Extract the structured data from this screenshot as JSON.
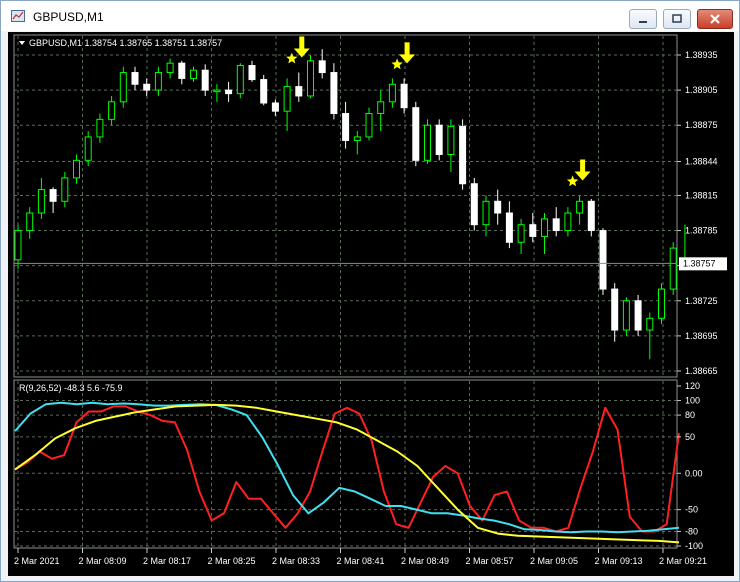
{
  "window": {
    "title": "GBPUSD,M1"
  },
  "chart": {
    "header": "GBPUSD,M1  1.38754 1.38765 1.38751 1.38757",
    "symbol": "GBPUSD",
    "timeframe": "M1",
    "ohlc": {
      "open": "1.38754",
      "high": "1.38765",
      "low": "1.38751",
      "close": "1.38757"
    },
    "price_axis_labels": [
      "1.38935",
      "1.38905",
      "1.38875",
      "1.38844",
      "1.38815",
      "1.38785",
      "1.38755",
      "1.38725",
      "1.38695",
      "1.38665"
    ],
    "price_axis_values": [
      1.38935,
      1.38905,
      1.38875,
      1.38844,
      1.38815,
      1.38785,
      1.38755,
      1.38725,
      1.38695,
      1.38665
    ],
    "current_price": "1.38757",
    "current_price_value": 1.38757,
    "colors": {
      "background": "#000000",
      "bull": "#00ff00",
      "bear": "#ffffff",
      "grid": "#5a6b5a",
      "marker": "#ffff00"
    },
    "signal_markers": [
      {
        "candle": 24,
        "icons": [
          "star-icon",
          "arrow-down-icon"
        ]
      },
      {
        "candle": 33,
        "icons": [
          "star-icon",
          "arrow-down-icon"
        ]
      },
      {
        "candle": 48,
        "icons": [
          "star-icon",
          "arrow-down-icon"
        ]
      }
    ]
  },
  "indicator": {
    "header": "R(9,26,52) -48.3 5.6 -75.9",
    "name": "R",
    "params": "(9,26,52)",
    "values": [
      "-48.3",
      "5.6",
      "-75.9"
    ],
    "axis_labels": [
      "120",
      "100",
      "80",
      "50",
      "0.00",
      "-50",
      "-80",
      "-100"
    ],
    "axis_values": [
      120,
      100,
      80,
      50,
      0,
      -50,
      -80,
      -100
    ],
    "series": [
      {
        "color": "#ff2020",
        "values": [
          5,
          15,
          30,
          20,
          25,
          70,
          85,
          85,
          92,
          92,
          85,
          80,
          72,
          70,
          32,
          -25,
          -65,
          -55,
          -12,
          -35,
          -35,
          -55,
          -75,
          -55,
          -25,
          30,
          82,
          90,
          82,
          45,
          -25,
          -70,
          -75,
          -40,
          -5,
          10,
          0,
          -45,
          -65,
          -30,
          -25,
          -65,
          -75,
          -75,
          -80,
          -75,
          -20,
          30,
          90,
          60,
          -60,
          -80,
          -80,
          -70,
          55
        ]
      },
      {
        "color": "#40e0f0",
        "values": [
          58,
          82,
          95,
          97,
          95,
          97,
          95,
          96,
          95,
          93,
          93,
          94,
          95,
          94,
          88,
          80,
          50,
          12,
          -30,
          -55,
          -40,
          -20,
          -25,
          -35,
          -45,
          -45,
          -50,
          -55,
          -55,
          -58,
          -62,
          -65,
          -70,
          -77,
          -78,
          -80,
          -81,
          -80,
          -80,
          -81,
          -80,
          -79,
          -77,
          -75
        ]
      },
      {
        "color": "#ffff33",
        "values": [
          5,
          25,
          48,
          62,
          72,
          78,
          84,
          88,
          92,
          93,
          94,
          93,
          90,
          85,
          80,
          75,
          70,
          60,
          45,
          30,
          10,
          -20,
          -50,
          -75,
          -83,
          -86,
          -87,
          -88,
          -89,
          -90,
          -91,
          -92,
          -93,
          -95
        ]
      }
    ]
  },
  "time_axis_labels": [
    "2 Mar 2021",
    "2 Mar 08:09",
    "2 Mar 08:17",
    "2 Mar 08:25",
    "2 Mar 08:33",
    "2 Mar 08:41",
    "2 Mar 08:49",
    "2 Mar 08:57",
    "2 Mar 09:05",
    "2 Mar 09:13",
    "2 Mar 09:21"
  ],
  "candles": [
    [
      1.3876,
      1.3879,
      1.38752,
      1.38785
    ],
    [
      1.38785,
      1.38805,
      1.38778,
      1.388
    ],
    [
      1.388,
      1.3883,
      1.38795,
      1.3882
    ],
    [
      1.3882,
      1.38822,
      1.388,
      1.3881
    ],
    [
      1.3881,
      1.38835,
      1.38805,
      1.3883
    ],
    [
      1.3883,
      1.3885,
      1.38825,
      1.38845
    ],
    [
      1.38845,
      1.3887,
      1.3884,
      1.38865
    ],
    [
      1.38865,
      1.38885,
      1.3886,
      1.3888
    ],
    [
      1.3888,
      1.389,
      1.38875,
      1.38895
    ],
    [
      1.38895,
      1.38925,
      1.3889,
      1.3892
    ],
    [
      1.3892,
      1.38925,
      1.38905,
      1.3891
    ],
    [
      1.3891,
      1.38915,
      1.389,
      1.38905
    ],
    [
      1.38905,
      1.38925,
      1.389,
      1.3892
    ],
    [
      1.3892,
      1.38932,
      1.38915,
      1.38928
    ],
    [
      1.38928,
      1.3893,
      1.3891,
      1.38915
    ],
    [
      1.38915,
      1.38925,
      1.38912,
      1.38922
    ],
    [
      1.38922,
      1.38927,
      1.389,
      1.38905
    ],
    [
      1.38905,
      1.3891,
      1.38895,
      1.38905
    ],
    [
      1.38905,
      1.38912,
      1.38895,
      1.38902
    ],
    [
      1.38902,
      1.38928,
      1.38898,
      1.38926
    ],
    [
      1.38926,
      1.3893,
      1.38912,
      1.38914
    ],
    [
      1.38914,
      1.38918,
      1.38892,
      1.38894
    ],
    [
      1.38894,
      1.38897,
      1.38883,
      1.38887
    ],
    [
      1.38887,
      1.38915,
      1.3887,
      1.38908
    ],
    [
      1.38908,
      1.3892,
      1.38895,
      1.389
    ],
    [
      1.389,
      1.38935,
      1.38898,
      1.3893
    ],
    [
      1.3893,
      1.3894,
      1.38915,
      1.3892
    ],
    [
      1.3892,
      1.38928,
      1.3888,
      1.38885
    ],
    [
      1.38885,
      1.38895,
      1.38855,
      1.38862
    ],
    [
      1.38862,
      1.3887,
      1.3885,
      1.38865
    ],
    [
      1.38865,
      1.3889,
      1.38862,
      1.38885
    ],
    [
      1.38885,
      1.38905,
      1.3887,
      1.38895
    ],
    [
      1.38895,
      1.38915,
      1.3889,
      1.3891
    ],
    [
      1.3891,
      1.38915,
      1.38885,
      1.3889
    ],
    [
      1.3889,
      1.38895,
      1.3884,
      1.38845
    ],
    [
      1.38845,
      1.3888,
      1.38842,
      1.38875
    ],
    [
      1.38875,
      1.3888,
      1.38845,
      1.3885
    ],
    [
      1.3885,
      1.3888,
      1.38835,
      1.38874
    ],
    [
      1.38874,
      1.3888,
      1.3882,
      1.38825
    ],
    [
      1.38825,
      1.3883,
      1.38785,
      1.3879
    ],
    [
      1.3879,
      1.38815,
      1.3878,
      1.3881
    ],
    [
      1.3881,
      1.3882,
      1.3879,
      1.388
    ],
    [
      1.388,
      1.3881,
      1.3877,
      1.38775
    ],
    [
      1.38775,
      1.38795,
      1.38765,
      1.3879
    ],
    [
      1.3879,
      1.388,
      1.38775,
      1.3878
    ],
    [
      1.3878,
      1.388,
      1.38765,
      1.38795
    ],
    [
      1.38795,
      1.38805,
      1.3878,
      1.38785
    ],
    [
      1.38785,
      1.38805,
      1.3878,
      1.388
    ],
    [
      1.388,
      1.38815,
      1.3879,
      1.3881
    ],
    [
      1.3881,
      1.38812,
      1.3878,
      1.38785
    ],
    [
      1.38785,
      1.38787,
      1.3873,
      1.38735
    ],
    [
      1.38735,
      1.3874,
      1.3869,
      1.387
    ],
    [
      1.387,
      1.38728,
      1.38695,
      1.38725
    ],
    [
      1.38725,
      1.3873,
      1.38695,
      1.387
    ],
    [
      1.387,
      1.38715,
      1.38675,
      1.3871
    ],
    [
      1.3871,
      1.3874,
      1.38705,
      1.38735
    ],
    [
      1.38735,
      1.38775,
      1.3873,
      1.3877
    ],
    [
      1.38754,
      1.3879,
      1.38751,
      1.38757
    ]
  ]
}
